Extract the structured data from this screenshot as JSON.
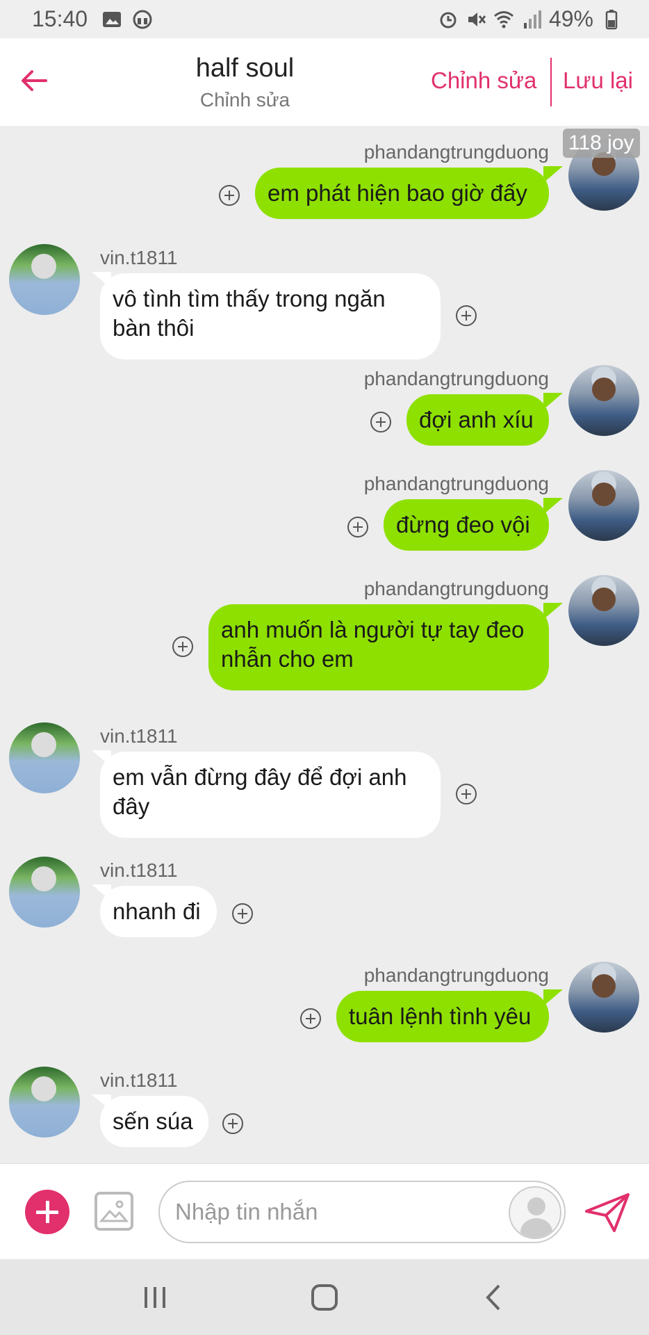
{
  "status_bar": {
    "time": "15:40",
    "battery": "49%",
    "icons": [
      "image-icon",
      "headphones-icon",
      "alarm-icon",
      "mute-icon",
      "wifi-icon",
      "signal-icon",
      "battery-icon"
    ]
  },
  "header": {
    "title": "half soul",
    "subtitle": "Chỉnh sửa",
    "edit_label": "Chỉnh sửa",
    "save_label": "Lưu lại",
    "accent_color": "#e1306c"
  },
  "badge": "118 joy",
  "messages": [
    {
      "direction": "out",
      "sender": "phandangtrungduong",
      "text": "em phát hiện bao giờ đấy"
    },
    {
      "direction": "in",
      "sender": "vin.t1811",
      "text": "vô tình tìm thấy trong ngăn bàn thôi"
    },
    {
      "direction": "out",
      "sender": "phandangtrungduong",
      "text": "đợi anh xíu"
    },
    {
      "direction": "out",
      "sender": "phandangtrungduong",
      "text": "đừng đeo vội"
    },
    {
      "direction": "out",
      "sender": "phandangtrungduong",
      "text": "anh muốn là người tự tay đeo nhẫn cho em"
    },
    {
      "direction": "in",
      "sender": "vin.t1811",
      "text": "em vẫn đừng đây để đợi anh đây"
    },
    {
      "direction": "in",
      "sender": "vin.t1811",
      "text": "nhanh đi"
    },
    {
      "direction": "out",
      "sender": "phandangtrungduong",
      "text": "tuân lệnh tình yêu"
    },
    {
      "direction": "in",
      "sender": "vin.t1811",
      "text": "sến súa"
    }
  ],
  "composer": {
    "placeholder": "Nhập tin nhắn"
  },
  "colors": {
    "outgoing_bubble": "#8ee000",
    "incoming_bubble": "#ffffff",
    "chat_background": "#ededed"
  }
}
